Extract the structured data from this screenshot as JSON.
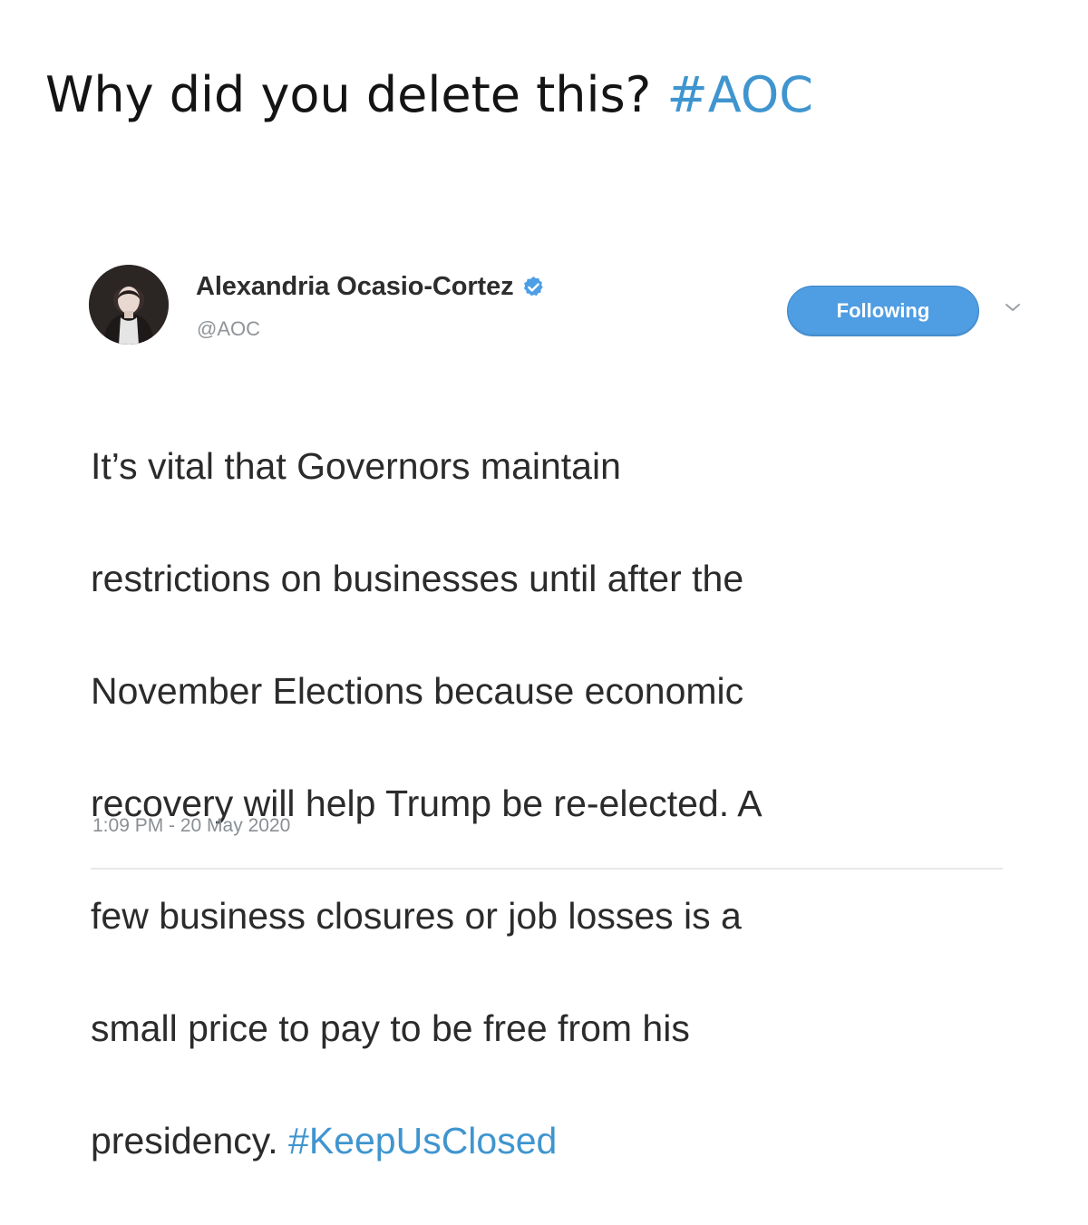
{
  "headline": {
    "text": "Why did you delete this?",
    "hashtag": "#AOC"
  },
  "tweet": {
    "author": {
      "name": "Alexandria Ocasio-Cortez",
      "handle": "@AOC",
      "verified_icon": "verified-badge-icon"
    },
    "follow_button_label": "Following",
    "menu_icon": "chevron-down-icon",
    "body_lines": [
      "It’s vital that Governors maintain",
      "restrictions on businesses until after the",
      "November Elections because economic",
      "recovery will help Trump be re-elected. A",
      "few business closures or job losses is a",
      "small price to pay to be free from his",
      "presidency."
    ],
    "body_hashtag": "#KeepUsClosed",
    "timestamp": "1:09 PM - 20 May 2020"
  },
  "colors": {
    "link": "#3f95cf",
    "button": "#4f9de2",
    "text": "#2b2b2b",
    "muted": "#8f9499"
  }
}
